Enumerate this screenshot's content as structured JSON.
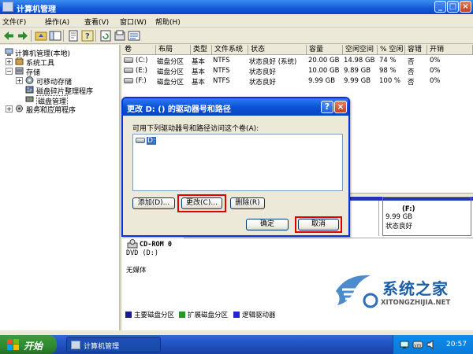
{
  "window": {
    "title": "计算机管理"
  },
  "menubar": [
    "文件(F)",
    "操作(A)",
    "查看(V)",
    "窗口(W)",
    "帮助(H)"
  ],
  "tree": {
    "root": "计算机管理(本地)",
    "system_tools": "系统工具",
    "storage": "存储",
    "removable": "可移动存储",
    "defrag": "磁盘碎片整理程序",
    "disk_mgmt": "磁盘管理",
    "services": "服务和应用程序"
  },
  "volume_table": {
    "headers": [
      "卷",
      "布局",
      "类型",
      "文件系统",
      "状态",
      "容量",
      "空闲空间",
      "% 空闲",
      "容错",
      "开销"
    ],
    "rows": [
      {
        "vol": "(C:)",
        "layout": "磁盘分区",
        "type": "基本",
        "fs": "NTFS",
        "status": "状态良好 (系统)",
        "capacity": "20.00 GB",
        "free": "14.98 GB",
        "pct": "74 %",
        "fault": "否",
        "overhead": "0%"
      },
      {
        "vol": "(E:)",
        "layout": "磁盘分区",
        "type": "基本",
        "fs": "NTFS",
        "status": "状态良好",
        "capacity": "10.00 GB",
        "free": "9.89 GB",
        "pct": "98 %",
        "fault": "否",
        "overhead": "0%"
      },
      {
        "vol": "(F:)",
        "layout": "磁盘分区",
        "type": "基本",
        "fs": "NTFS",
        "status": "状态良好",
        "capacity": "9.99 GB",
        "free": "9.99 GB",
        "pct": "100 %",
        "fault": "否",
        "overhead": "0%"
      }
    ]
  },
  "disk_partition_f": {
    "label": "(F:)",
    "size": "9.99 GB",
    "status": "状态良好"
  },
  "cdrom": {
    "name": "CD-ROM 0",
    "type": "DVD (D:)",
    "media": "无媒体"
  },
  "legend": [
    {
      "label": "主要磁盘分区",
      "color": "#1a1a8c"
    },
    {
      "label": "扩展磁盘分区",
      "color": "#1f9b1f"
    },
    {
      "label": "逻辑驱动器",
      "color": "#2424d6"
    }
  ],
  "dialog": {
    "title": "更改 D: () 的驱动器号和路径",
    "prompt": "可用下列驱动器号和路径访问这个卷(A):",
    "list_item": "D:",
    "add_label": "添加(D)...",
    "change_label": "更改(C)...",
    "delete_label": "删除(R)",
    "ok_label": "确定",
    "cancel_label": "取消",
    "help_symbol": "?",
    "close_symbol": "×"
  },
  "taskbar": {
    "start_label": "开始",
    "task_label": "计算机管理",
    "clock": "20:57"
  },
  "watermark": {
    "name": "系统之家",
    "url": "XITONGZHIJIA.NET"
  }
}
